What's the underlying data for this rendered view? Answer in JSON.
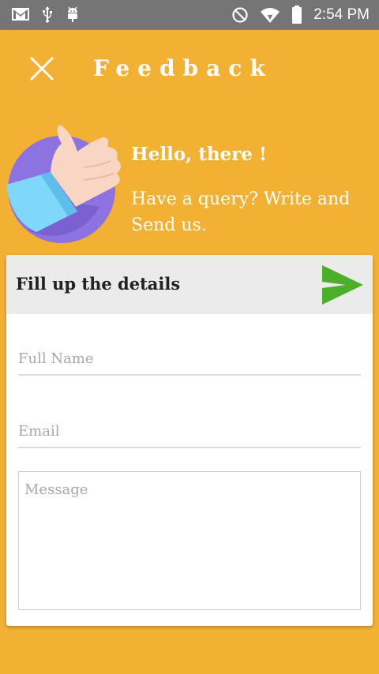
{
  "status_bar": {
    "time": "2:54 PM",
    "left_icons": [
      "gmail-icon",
      "usb-icon",
      "android-debug-icon"
    ],
    "right_icons": [
      "do-not-disturb-icon",
      "wifi-icon",
      "battery-icon"
    ]
  },
  "header": {
    "title": "Feedback",
    "close_icon": "close-icon"
  },
  "hero": {
    "greeting": "Hello, there !",
    "subtitle": "Have a query? Write and Send us."
  },
  "form": {
    "heading": "Fill up the details",
    "send_icon": "send-icon",
    "full_name_placeholder": "Full Name",
    "email_placeholder": "Email",
    "message_placeholder": "Message"
  },
  "colors": {
    "background": "#F3B134",
    "status_bar": "#757575",
    "card_header": "#EBEBEB",
    "send": "#4CAF2A",
    "illustration_circle": "#8D72E1"
  }
}
